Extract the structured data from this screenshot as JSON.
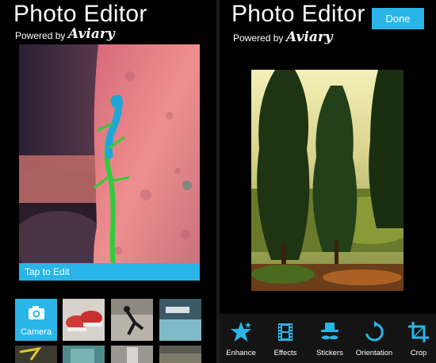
{
  "left": {
    "title": "Photo Editor",
    "powered_by": "Powered by",
    "brand": "Aviary",
    "tap_to_edit": "Tap to Edit",
    "camera_label": "Camera"
  },
  "right": {
    "title": "Photo Editor",
    "powered_by": "Powered by",
    "brand": "Aviary",
    "done_label": "Done",
    "tools": [
      {
        "label": "Enhance",
        "icon": "star-icon"
      },
      {
        "label": "Effects",
        "icon": "film-icon"
      },
      {
        "label": "Stickers",
        "icon": "hat-mustache-icon"
      },
      {
        "label": "Orientation",
        "icon": "rotate-icon"
      },
      {
        "label": "Crop",
        "icon": "crop-icon"
      }
    ]
  },
  "colors": {
    "accent": "#29b5e8",
    "background": "#000000",
    "toolbar": "#141414"
  }
}
